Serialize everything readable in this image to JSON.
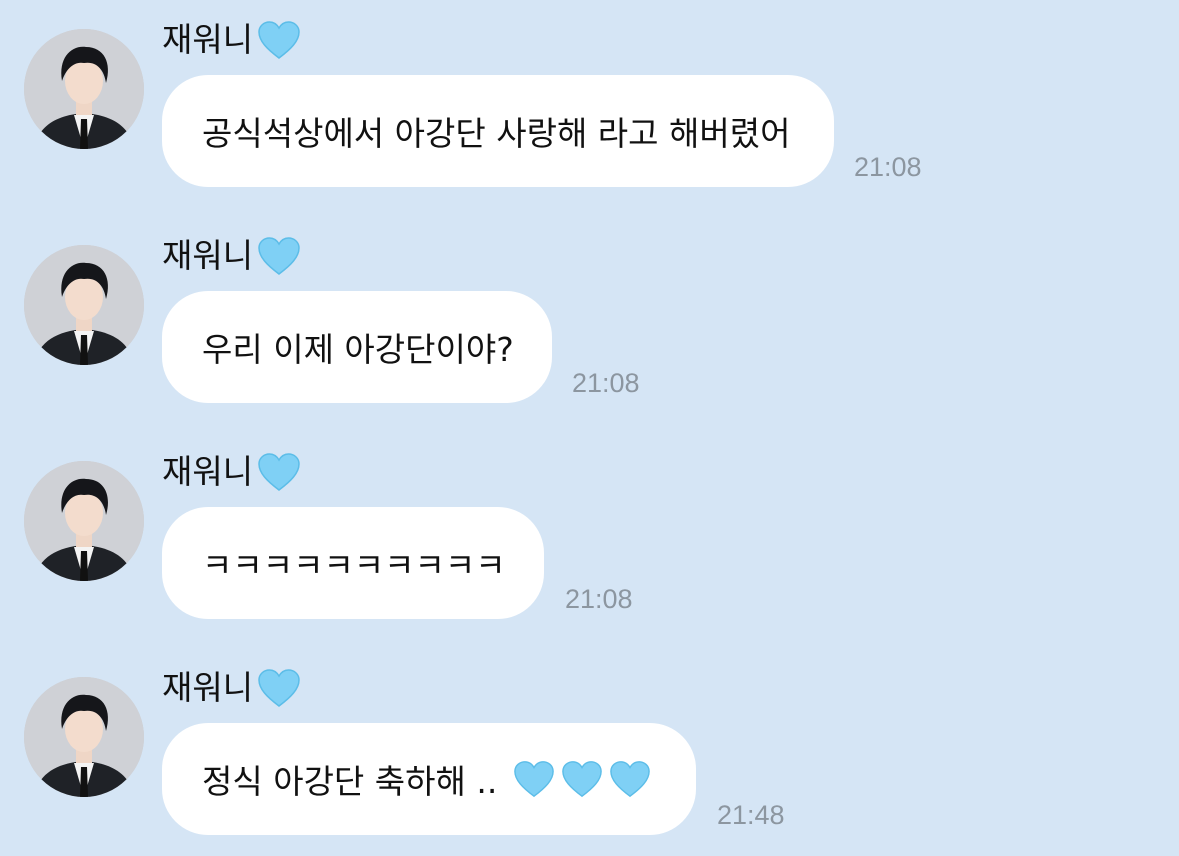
{
  "messages": [
    {
      "sender": "재워니",
      "text": "공식석상에서 아강단 사랑해 라고 해버렸어",
      "time": "21:08",
      "hearts": 0
    },
    {
      "sender": "재워니",
      "text": "우리 이제 아강단이야?",
      "time": "21:08",
      "hearts": 0
    },
    {
      "sender": "재워니",
      "text": "ㅋㅋㅋㅋㅋㅋㅋㅋㅋㅋ",
      "time": "21:08",
      "hearts": 0
    },
    {
      "sender": "재워니",
      "text": "정식 아강단 축하해 ..",
      "time": "21:48",
      "hearts": 3
    }
  ],
  "sender_icon": "light-blue-heart-icon",
  "colors": {
    "background": "#d5e5f5",
    "bubble": "#ffffff",
    "heart": "#7fd0f5",
    "time_text": "#8c96a0"
  }
}
